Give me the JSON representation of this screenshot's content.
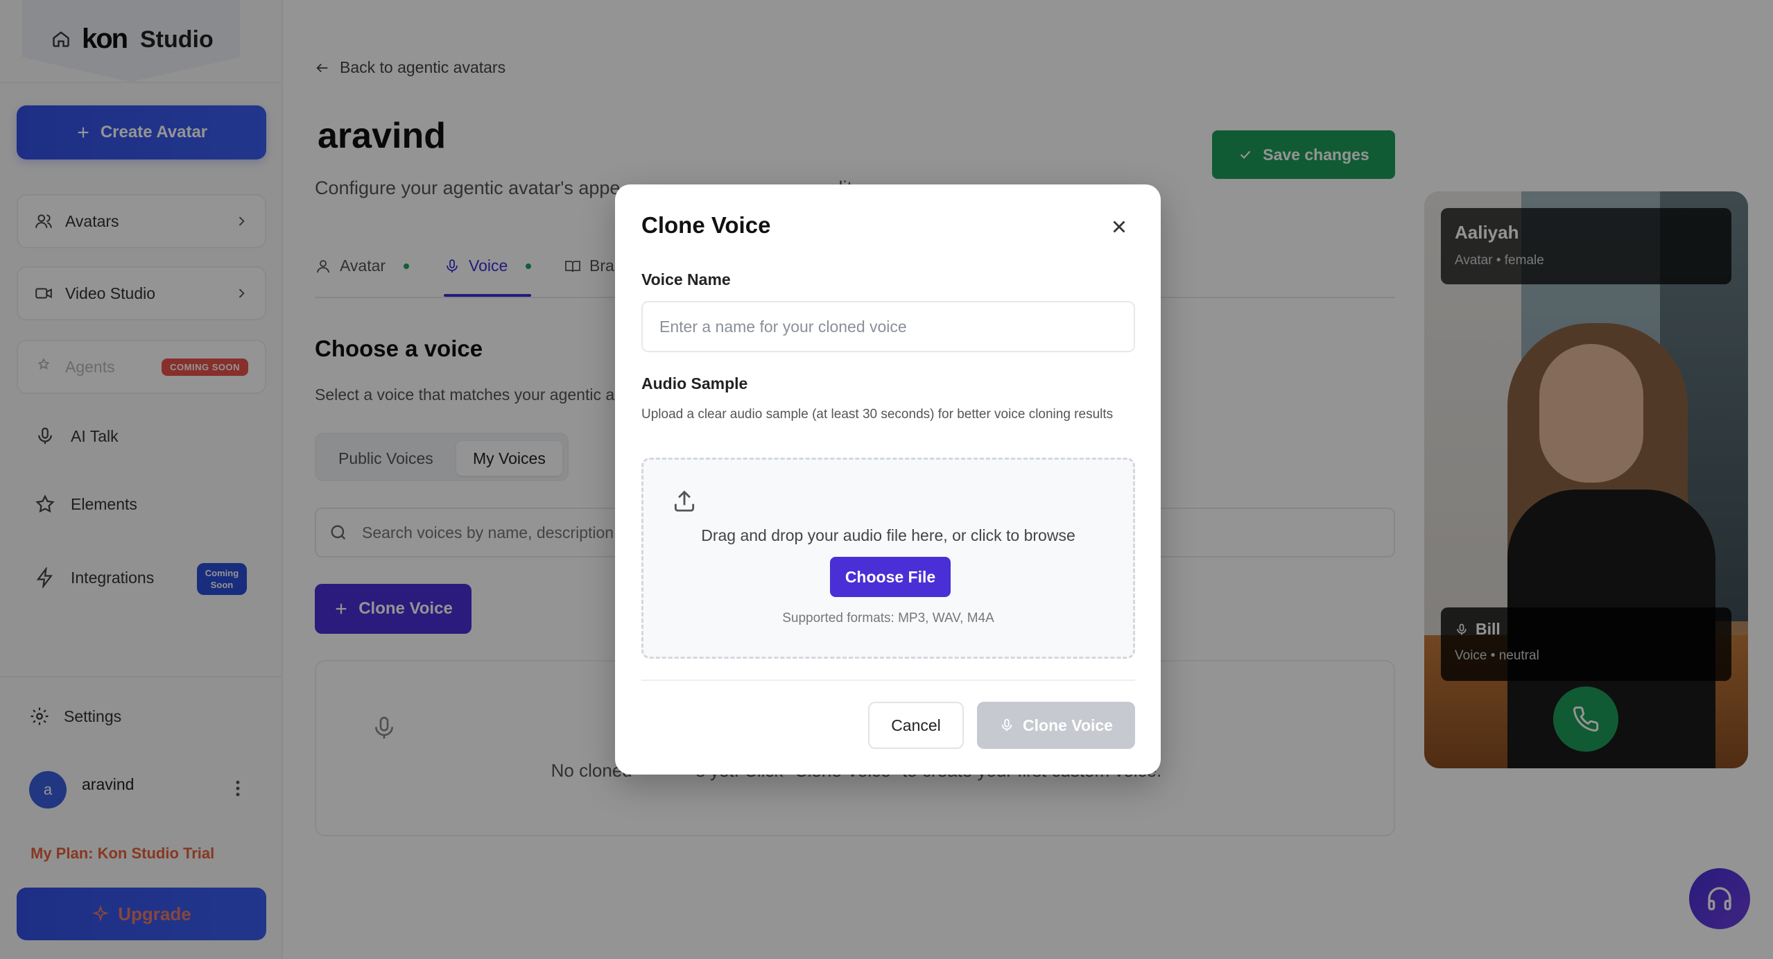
{
  "sidebar": {
    "brand_logo": "kon",
    "brand_name": "Studio",
    "create_label": "Create Avatar",
    "items": [
      {
        "label": "Avatars"
      },
      {
        "label": "Video Studio"
      },
      {
        "label": "Agents",
        "badge": "COMING SOON"
      },
      {
        "label": "AI Talk"
      },
      {
        "label": "Elements"
      },
      {
        "label": "Integrations",
        "badge_line1": "Coming",
        "badge_line2": "Soon"
      }
    ],
    "settings_label": "Settings",
    "user": {
      "initial": "a",
      "name": "aravind"
    },
    "plan_label": "My Plan: Kon Studio Trial",
    "upgrade_label": "Upgrade"
  },
  "main": {
    "back_label": "Back to agentic avatars",
    "title": "aravind",
    "subtitle": "Configure your agentic avatar's appe",
    "subtitle_tail": "ality.",
    "save_label": "Save changes",
    "tabs": [
      {
        "label": "Avatar"
      },
      {
        "label": "Voice"
      },
      {
        "label": "Bra"
      }
    ],
    "section_title": "Choose a voice",
    "section_sub": "Select a voice that matches your agentic a",
    "segments": [
      {
        "label": "Public Voices"
      },
      {
        "label": "My Voices"
      }
    ],
    "search_placeholder": "Search voices by name, description",
    "clone_label": "Clone Voice",
    "empty_left": "No cloned",
    "empty_right": "s yet. Click \"Clone Voice\" to create your first custom voice."
  },
  "preview": {
    "avatar_name": "Aaliyah",
    "avatar_meta": "Avatar • female",
    "voice_name": "Bill",
    "voice_meta": "Voice • neutral"
  },
  "modal": {
    "title": "Clone Voice",
    "name_label": "Voice Name",
    "name_placeholder": "Enter a name for your cloned voice",
    "sample_label": "Audio Sample",
    "sample_help": "Upload a clear audio sample (at least 30 seconds) for better voice cloning results",
    "drop_text": "Drag and drop your audio file here, or click to browse",
    "choose_label": "Choose File",
    "formats": "Supported formats: MP3, WAV, M4A",
    "cancel_label": "Cancel",
    "submit_label": "Clone Voice"
  },
  "colors": {
    "accent": "#4a2fd6",
    "primary_blue": "#3550e6",
    "success": "#1e9e5a",
    "danger_badge": "#e8524a"
  }
}
